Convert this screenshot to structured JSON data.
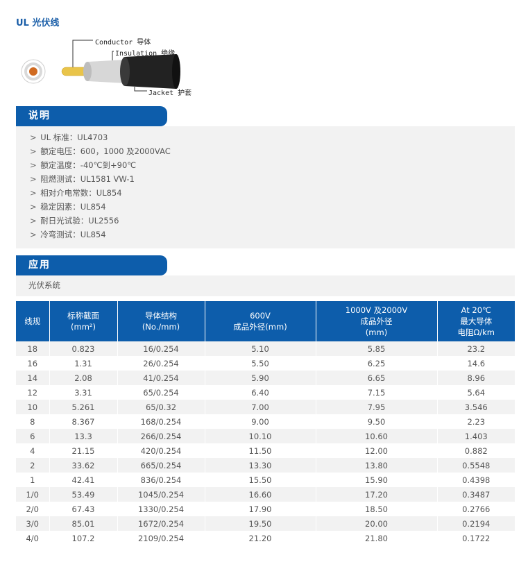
{
  "page_title": "UL 光伏线",
  "diagram": {
    "conductor": "Conductor 导体",
    "insulation": "Insulation 绝缘",
    "jacket": "Jacket 护套",
    "colors": {
      "jacket": "#222222",
      "insulation": "#d7d7d7",
      "conductor": "#e9c44a",
      "core": "#d06a20"
    }
  },
  "description": {
    "heading": "说明",
    "bullet": ">",
    "items": [
      "UL 标准：UL4703",
      "额定电压：600，1000 及2000VAC",
      "额定温度：-40℃到+90℃",
      "阻燃测试：UL1581 VW-1",
      "相对介电常数：UL854",
      "稳定因素：UL854",
      "耐日光试验：UL2556",
      "冷弯测试：UL854"
    ]
  },
  "application": {
    "heading": "应用",
    "text": "光伏系统"
  },
  "table": {
    "headers": [
      [
        "线规"
      ],
      [
        "标称截面",
        "(mm²)"
      ],
      [
        "导体结构",
        "(No./mm)"
      ],
      [
        "600V",
        "成品外径(mm)"
      ],
      [
        "1000V 及2000V",
        "成品外径",
        "(mm)"
      ],
      [
        "At 20℃",
        "最大导体",
        "电阻Ω/km"
      ]
    ],
    "rows": [
      [
        "18",
        "0.823",
        "16/0.254",
        "5.10",
        "5.85",
        "23.2"
      ],
      [
        "16",
        "1.31",
        "26/0.254",
        "5.50",
        "6.25",
        "14.6"
      ],
      [
        "14",
        "2.08",
        "41/0.254",
        "5.90",
        "6.65",
        "8.96"
      ],
      [
        "12",
        "3.31",
        "65/0.254",
        "6.40",
        "7.15",
        "5.64"
      ],
      [
        "10",
        "5.261",
        "65/0.32",
        "7.00",
        "7.95",
        "3.546"
      ],
      [
        "8",
        "8.367",
        "168/0.254",
        "9.00",
        "9.50",
        "2.23"
      ],
      [
        "6",
        "13.3",
        "266/0.254",
        "10.10",
        "10.60",
        "1.403"
      ],
      [
        "4",
        "21.15",
        "420/0.254",
        "11.50",
        "12.00",
        "0.882"
      ],
      [
        "2",
        "33.62",
        "665/0.254",
        "13.30",
        "13.80",
        "0.5548"
      ],
      [
        "1",
        "42.41",
        "836/0.254",
        "15.50",
        "15.90",
        "0.4398"
      ],
      [
        "1/0",
        "53.49",
        "1045/0.254",
        "16.60",
        "17.20",
        "0.3487"
      ],
      [
        "2/0",
        "67.43",
        "1330/0.254",
        "17.90",
        "18.50",
        "0.2766"
      ],
      [
        "3/0",
        "85.01",
        "1672/0.254",
        "19.50",
        "20.00",
        "0.2194"
      ],
      [
        "4/0",
        "107.2",
        "2109/0.254",
        "21.20",
        "21.80",
        "0.1722"
      ]
    ]
  }
}
